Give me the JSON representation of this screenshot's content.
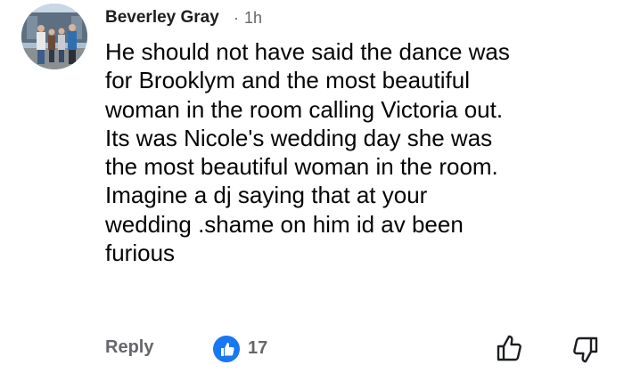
{
  "comment": {
    "author": "Beverley Gray",
    "separator": "·",
    "time": "1h",
    "lines": [
      "He should not have said the dance was",
      "for Brooklym and the most beautiful",
      "woman in the room calling Victoria out.",
      "Its was Nicole's wedding day she was",
      "the most beautiful woman in the room.",
      "Imagine a dj saying that at your",
      "wedding .shame on him id av been",
      "furious"
    ]
  },
  "actions": {
    "reply_label": "Reply",
    "like_count": "17",
    "like_icon": "thumbs-up-icon",
    "dislike_icon": "thumbs-down-icon"
  },
  "colors": {
    "text": "#050505",
    "muted": "#65676b",
    "like_badge": "#1877f2"
  }
}
